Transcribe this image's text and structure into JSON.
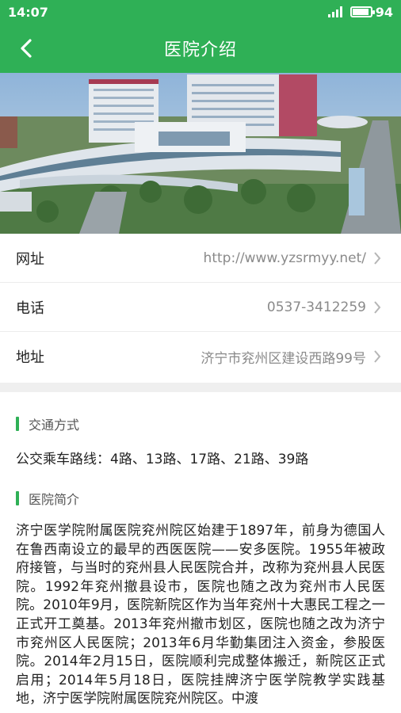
{
  "status_bar": {
    "time": "14:07",
    "battery": "94"
  },
  "nav": {
    "title": "医院介绍"
  },
  "info": {
    "rows": [
      {
        "label": "网址",
        "value": "http://www.yzsrmyy.net/"
      },
      {
        "label": "电话",
        "value": "0537-3412259"
      },
      {
        "label": "地址",
        "value": "济宁市兖州区建设西路99号"
      }
    ]
  },
  "transport": {
    "heading": "交通方式",
    "bus": "公交乘车路线：4路、13路、17路、21路、39路"
  },
  "intro": {
    "heading": "医院简介",
    "text": "济宁医学院附属医院兖州院区始建于1897年，前身为德国人在鲁西南设立的最早的西医医院——安多医院。1955年被政府接管，与当时的兖州县人民医院合并，改称为兖州县人民医院。1992年兖州撤县设市，医院也随之改为兖州市人民医院。2010年9月，医院新院区作为当年兖州十大惠民工程之一正式开工奠基。2013年兖州撤市划区，医院也随之改为济宁市兖州区人民医院；2013年6月华勤集团注入资金，参股医院。2014年2月15日，医院顺利完成整体搬迁，新院区正式启用；2014年5月18日，医院挂牌济宁医学院教学实践基地，济宁医学院附属医院兖州院区。中渡"
  }
}
